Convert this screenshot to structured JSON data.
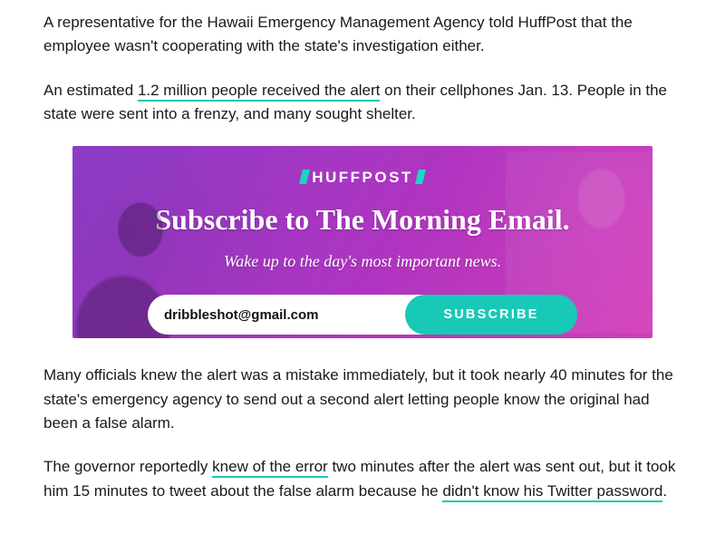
{
  "article": {
    "p1": "A representative for the Hawaii Emergency Management Agency told HuffPost that the employee wasn't cooperating with the state's investigation either.",
    "p2a": "An estimated ",
    "p2_link": "1.2 million people received the alert",
    "p2b": " on their cellphones Jan. 13. People in the state were sent into a frenzy, and many sought shelter.",
    "p3": "Many officials knew the alert was a mistake immediately, but it took nearly 40 minutes for the state's emergency agency to send out a second alert letting people know the original had been a false alarm.",
    "p4a": "The governor reportedly ",
    "p4_link1": "knew of the error",
    "p4b": " two minutes after the alert was sent out, but it took him 15 minutes to tweet about the false alarm because he ",
    "p4_link2": "didn't know his Twitter password",
    "p4c": "."
  },
  "promo": {
    "brand": "HUFFPOST",
    "headline": "Subscribe to The Morning Email.",
    "subhead": "Wake up to the day's most important news.",
    "email_value": "dribbleshot@gmail.com",
    "subscribe_label": "SUBSCRIBE"
  },
  "colors": {
    "accent_teal": "#18c9b7",
    "gradient_start": "#8a3cc8",
    "gradient_end": "#e23cb4"
  }
}
